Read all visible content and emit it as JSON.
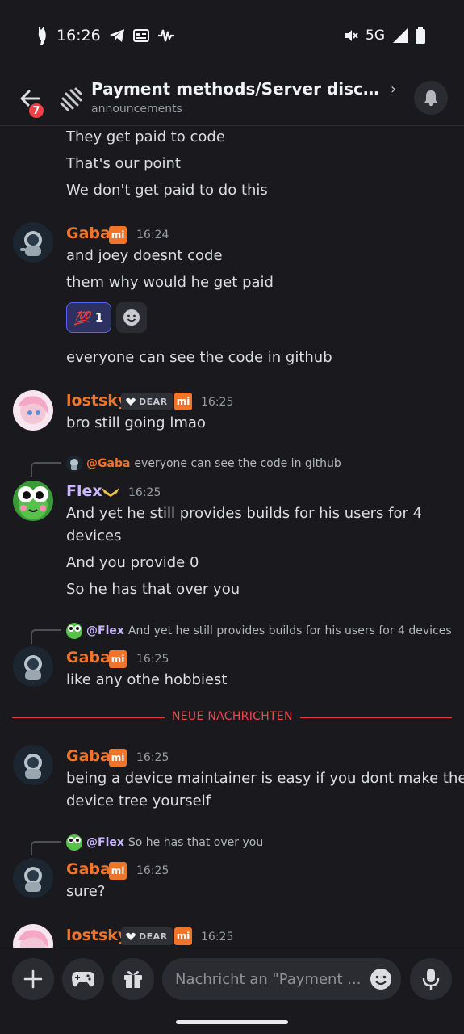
{
  "status_bar": {
    "time": "16:26",
    "network": "5G"
  },
  "header": {
    "unread_count": "7",
    "title": "Payment methods/Server discuss...",
    "subtitle": "announcements"
  },
  "colors": {
    "accent": "#5865f2",
    "orange_name": "#f0742a",
    "flex_name": "#c9b6ff",
    "new_messages": "#f0474a"
  },
  "messages": {
    "m0_lines": [
      "They get paid to code",
      "That's our point",
      "We don't get paid to do this"
    ],
    "m1": {
      "user": "Gaba",
      "time": "16:24",
      "lines": [
        "and joey doesnt code",
        "them why would he get paid"
      ],
      "reaction": {
        "emoji": "💯",
        "count": "1"
      },
      "after": "everyone can see the code in github"
    },
    "m2": {
      "user": "lostsky",
      "tag": "DEAR",
      "time": "16:25",
      "lines": [
        "bro still going lmao"
      ]
    },
    "m3": {
      "reply_mention": "@Gaba",
      "reply_text": "everyone can see the code in github",
      "user": "Flex",
      "time": "16:25",
      "lines": [
        "And yet he still provides builds for his users for 4",
        "devices",
        "And you provide 0",
        "So he has that over you"
      ]
    },
    "m4": {
      "reply_mention": "@Flex",
      "reply_text": "And yet he still provides builds for his users for 4 devices",
      "user": "Gaba",
      "time": "16:25",
      "lines": [
        "like any othe hobbiest"
      ]
    },
    "divider": "NEUE NACHRICHTEN",
    "m5": {
      "user": "Gaba",
      "time": "16:25",
      "lines": [
        "being a device maintainer is easy if you dont make the",
        "device tree yourself"
      ]
    },
    "m6": {
      "reply_mention": "@Flex",
      "reply_text": "So he has that over you",
      "user": "Gaba",
      "time": "16:25",
      "lines": [
        "sure?"
      ]
    },
    "m7": {
      "user": "lostsky",
      "tag": "DEAR",
      "time": "16:25"
    }
  },
  "composer": {
    "placeholder": "Nachricht an \"Payment ..."
  },
  "badge_mi": "mi"
}
